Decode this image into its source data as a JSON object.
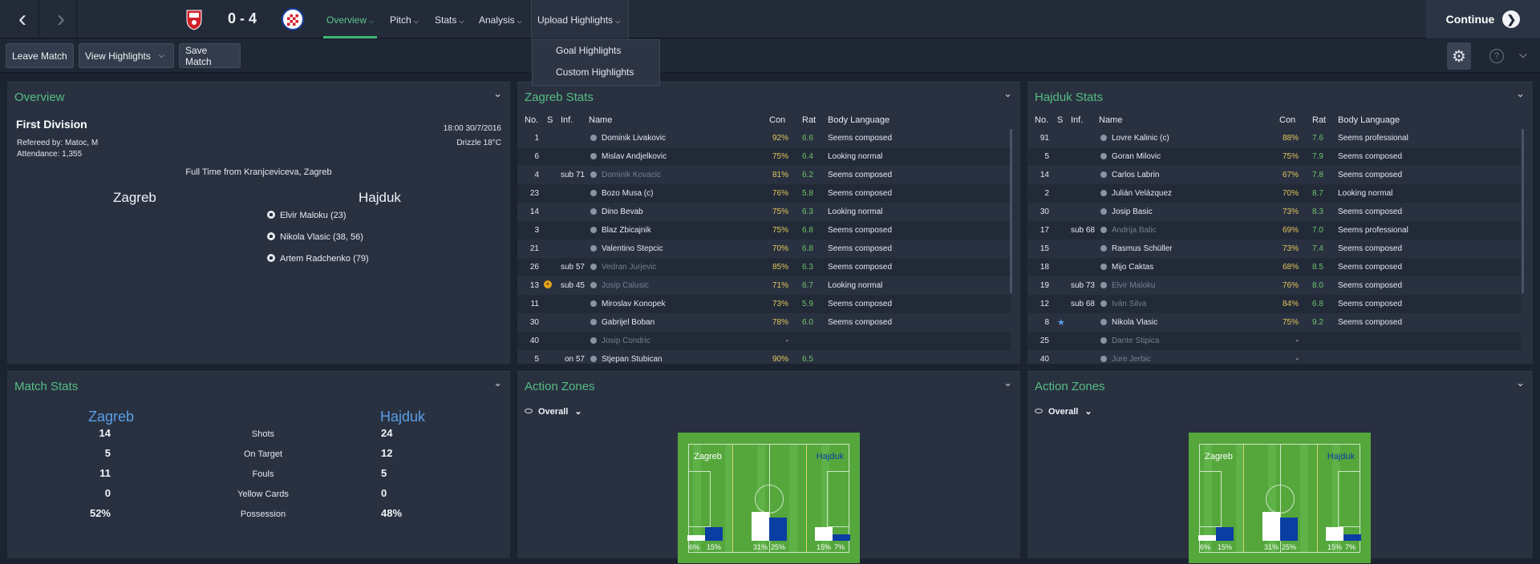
{
  "header": {
    "back_icon": "chevron-left-icon",
    "forward_icon": "chevron-right-icon",
    "score": "0 - 4",
    "tabs": [
      "Overview",
      "Pitch",
      "Stats",
      "Analysis",
      "Upload Highlights"
    ],
    "continue_label": "Continue"
  },
  "toolbar": {
    "leave_label": "Leave Match",
    "highlights_label": "View Highlights",
    "save_label": "Save Match"
  },
  "upload_menu": {
    "items": [
      "Goal Highlights",
      "Custom Highlights"
    ]
  },
  "colors": {
    "accent": "#3fb56f",
    "panel": "#293141",
    "home_bar": "#ffffff",
    "away_bar": "#0a3ea3",
    "title": "#55bd82"
  },
  "overview": {
    "title": "Overview",
    "division": "First Division",
    "referee": "Refereed by: Matoc, M",
    "attendance": "Attendance: 1,355",
    "datetime": "18:00 30/7/2016",
    "weather": "Drizzle 18°C",
    "result": "Full Time from Kranjceviceva, Zagreb",
    "home": "Zagreb",
    "away": "Hajduk",
    "scorers": [
      "Elvir Maloku (23)",
      "Nikola Vlasic (38, 56)",
      "Artem Radchenko (79)"
    ]
  },
  "zagreb_stats": {
    "title": "Zagreb Stats",
    "headers": [
      "No.",
      "S",
      "Inf.",
      "Name",
      "Con",
      "Rat",
      "Body Language"
    ],
    "rows": [
      {
        "no": "1",
        "inf": "",
        "name": "Dominik Livakovic",
        "con": "92%",
        "rat": "6.6",
        "body": "Seems composed",
        "dim": false
      },
      {
        "no": "6",
        "inf": "",
        "name": "Mislav Andjelkovic",
        "con": "75%",
        "rat": "6.4",
        "body": "Looking normal",
        "dim": false
      },
      {
        "no": "4",
        "inf": "sub 71",
        "name": "Dominik Kovacic",
        "con": "81%",
        "rat": "6.2",
        "body": "Seems composed",
        "dim": true
      },
      {
        "no": "23",
        "inf": "",
        "name": "Bozo Musa (c)",
        "con": "76%",
        "rat": "5.8",
        "body": "Seems composed",
        "dim": false
      },
      {
        "no": "14",
        "inf": "",
        "name": "Dino Bevab",
        "con": "75%",
        "rat": "6.3",
        "body": "Looking normal",
        "dim": false
      },
      {
        "no": "3",
        "inf": "",
        "name": "Blaz Zbicajnik",
        "con": "75%",
        "rat": "6.8",
        "body": "Seems composed",
        "dim": false
      },
      {
        "no": "21",
        "inf": "",
        "name": "Valentino Stepcic",
        "con": "70%",
        "rat": "6.8",
        "body": "Seems composed",
        "dim": false
      },
      {
        "no": "26",
        "inf": "sub 57",
        "name": "Vedran Jurjevic",
        "con": "85%",
        "rat": "6.3",
        "body": "Seems composed",
        "dim": true
      },
      {
        "no": "13",
        "inf": "sub 45",
        "name": "Josip Calusic",
        "con": "71%",
        "rat": "6.7",
        "body": "Looking normal",
        "dim": true,
        "flag": true
      },
      {
        "no": "11",
        "inf": "",
        "name": "Miroslav Konopek",
        "con": "73%",
        "rat": "5.9",
        "body": "Seems composed",
        "dim": false
      },
      {
        "no": "30",
        "inf": "",
        "name": "Gabrijel Boban",
        "con": "78%",
        "rat": "6.0",
        "body": "Seems composed",
        "dim": false
      },
      {
        "no": "40",
        "inf": "",
        "name": "Josip Condric",
        "con": "-",
        "rat": "",
        "body": "",
        "dim": true
      },
      {
        "no": "5",
        "inf": "on 57",
        "name": "Stjepan Stubican",
        "con": "90%",
        "rat": "6.5",
        "body": "",
        "dim": false
      }
    ]
  },
  "hajduk_stats": {
    "title": "Hajduk Stats",
    "headers": [
      "No.",
      "S",
      "Inf.",
      "Name",
      "Con",
      "Rat",
      "Body Language"
    ],
    "rows": [
      {
        "no": "91",
        "inf": "",
        "name": "Lovre Kalinic (c)",
        "con": "88%",
        "rat": "7.6",
        "body": "Seems professional",
        "dim": false
      },
      {
        "no": "5",
        "inf": "",
        "name": "Goran Milovic",
        "con": "75%",
        "rat": "7.9",
        "body": "Seems composed",
        "dim": false
      },
      {
        "no": "14",
        "inf": "",
        "name": "Carlos Labrin",
        "con": "67%",
        "rat": "7.8",
        "body": "Seems composed",
        "dim": false
      },
      {
        "no": "2",
        "inf": "",
        "name": "Julián Velázquez",
        "con": "70%",
        "rat": "8.7",
        "body": "Looking normal",
        "dim": false
      },
      {
        "no": "30",
        "inf": "",
        "name": "Josip Basic",
        "con": "73%",
        "rat": "8.3",
        "body": "Seems composed",
        "dim": false
      },
      {
        "no": "17",
        "inf": "sub 68",
        "name": "Andrija Balic",
        "con": "69%",
        "rat": "7.0",
        "body": "Seems professional",
        "dim": true
      },
      {
        "no": "15",
        "inf": "",
        "name": "Rasmus Schüller",
        "con": "73%",
        "rat": "7.4",
        "body": "Seems composed",
        "dim": false
      },
      {
        "no": "18",
        "inf": "",
        "name": "Mijo Caktas",
        "con": "68%",
        "rat": "8.5",
        "body": "Seems composed",
        "dim": false
      },
      {
        "no": "19",
        "inf": "sub 73",
        "name": "Elvir Maloku",
        "con": "76%",
        "rat": "8.0",
        "body": "Seems composed",
        "dim": true
      },
      {
        "no": "12",
        "inf": "sub 68",
        "name": "Iván Silva",
        "con": "84%",
        "rat": "6.8",
        "body": "Seems composed",
        "dim": true
      },
      {
        "no": "8",
        "inf": "",
        "name": "Nikola Vlasic",
        "con": "75%",
        "rat": "9.2",
        "body": "Seems composed",
        "dim": false,
        "star": true
      },
      {
        "no": "25",
        "inf": "",
        "name": "Dante Stipica",
        "con": "-",
        "rat": "",
        "body": "",
        "dim": true
      },
      {
        "no": "40",
        "inf": "",
        "name": "Jure Jerbic",
        "con": "-",
        "rat": "",
        "body": "",
        "dim": true
      }
    ]
  },
  "match_stats": {
    "title": "Match Stats",
    "home": "Zagreb",
    "away": "Hajduk",
    "rows": [
      {
        "home": "14",
        "label": "Shots",
        "away": "24"
      },
      {
        "home": "5",
        "label": "On Target",
        "away": "12"
      },
      {
        "home": "11",
        "label": "Fouls",
        "away": "5"
      },
      {
        "home": "0",
        "label": "Yellow Cards",
        "away": "0"
      },
      {
        "home": "52%",
        "label": "Possession",
        "away": "48%"
      }
    ]
  },
  "action_zones": [
    {
      "title": "Action Zones",
      "filter": "Overall",
      "home": "Zagreb",
      "away": "Hajduk",
      "zones": [
        {
          "home": 6,
          "away": 15
        },
        {
          "home": 31,
          "away": 25
        },
        {
          "home": 15,
          "away": 7
        }
      ],
      "labels": [
        "6%",
        "15%",
        "31%",
        "25%",
        "15%",
        "7%"
      ]
    },
    {
      "title": "Action Zones",
      "filter": "Overall",
      "home": "Zagreb",
      "away": "Hajduk",
      "zones": [
        {
          "home": 6,
          "away": 15
        },
        {
          "home": 31,
          "away": 25
        },
        {
          "home": 15,
          "away": 7
        }
      ],
      "labels": [
        "6%",
        "15%",
        "31%",
        "25%",
        "15%",
        "7%"
      ]
    }
  ]
}
